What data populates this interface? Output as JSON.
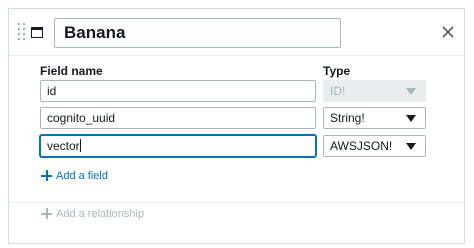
{
  "model": {
    "name": "Banana"
  },
  "columns": {
    "field_name": "Field name",
    "type": "Type"
  },
  "fields": [
    {
      "name": "id",
      "type": "ID!",
      "type_disabled": true
    },
    {
      "name": "cognito_uuid",
      "type": "String!",
      "type_disabled": false
    },
    {
      "name": "vector",
      "type": "AWSJSON!",
      "type_disabled": false,
      "focused": true
    }
  ],
  "actions": {
    "add_field": "Add a field",
    "add_relationship": "Add a relationship"
  },
  "icons": {
    "drag": "drag-handle-icon",
    "window": "window-icon",
    "close": "close-icon",
    "plus": "plus-icon",
    "dropdown": "caret-down-icon"
  },
  "colors": {
    "accent": "#0073bb",
    "border": "#aab7b8",
    "disabled_bg": "#eaeded",
    "text": "#16191f"
  }
}
